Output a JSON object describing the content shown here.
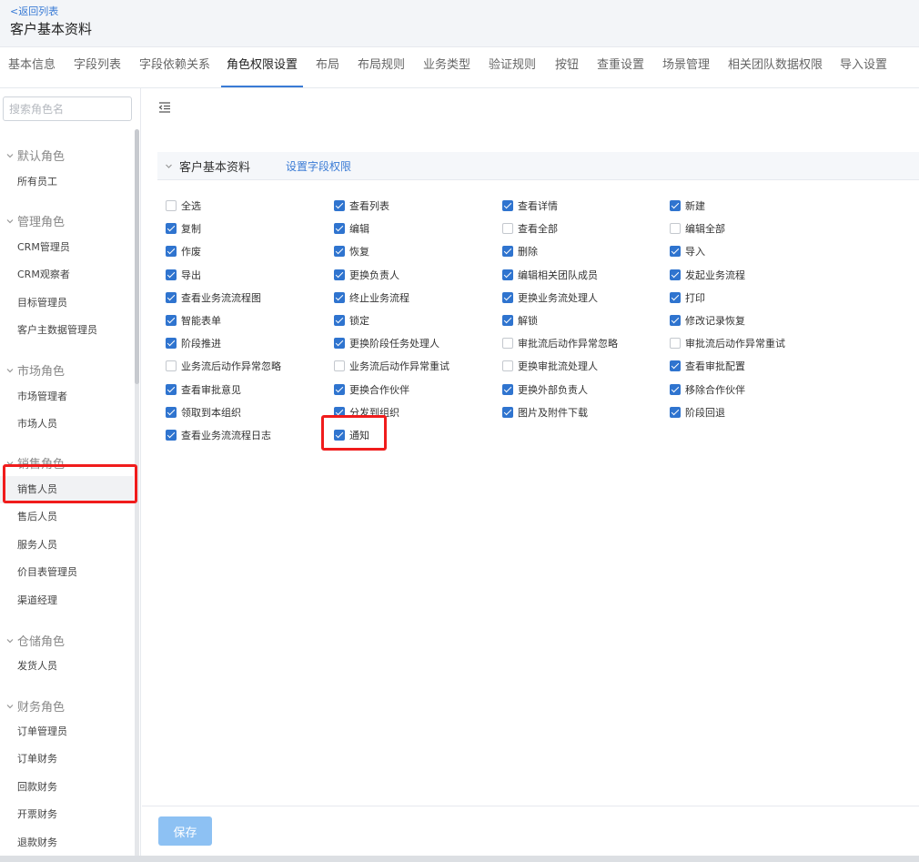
{
  "header": {
    "back_label": "<返回列表",
    "title": "客户基本资料"
  },
  "tabs": [
    "基本信息",
    "字段列表",
    "字段依赖关系",
    "角色权限设置",
    "布局",
    "布局规则",
    "业务类型",
    "验证规则",
    "按钮",
    "查重设置",
    "场景管理",
    "相关团队数据权限",
    "导入设置"
  ],
  "active_tab": "角色权限设置",
  "sidebar": {
    "search_placeholder": "搜索角色名",
    "groups": [
      {
        "label": "默认角色",
        "items": [
          "所有员工"
        ]
      },
      {
        "label": "管理角色",
        "items": [
          "CRM管理员",
          "CRM观察者",
          "目标管理员",
          "客户主数据管理员"
        ]
      },
      {
        "label": "市场角色",
        "items": [
          "市场管理者",
          "市场人员"
        ]
      },
      {
        "label": "销售角色",
        "items": [
          "销售人员",
          "售后人员",
          "服务人员",
          "价目表管理员",
          "渠道经理"
        ]
      },
      {
        "label": "仓储角色",
        "items": [
          "发货人员"
        ]
      },
      {
        "label": "财务角色",
        "items": [
          "订单管理员",
          "订单财务",
          "回款财务",
          "开票财务",
          "退款财务"
        ]
      }
    ],
    "selected_item": "销售人员"
  },
  "section": {
    "title": "客户基本资料",
    "link_label": "设置字段权限"
  },
  "permissions": [
    [
      "全选",
      false
    ],
    [
      "查看列表",
      true
    ],
    [
      "查看详情",
      true
    ],
    [
      "新建",
      true
    ],
    [
      "复制",
      true
    ],
    [
      "编辑",
      true
    ],
    [
      "查看全部",
      false
    ],
    [
      "编辑全部",
      false
    ],
    [
      "作废",
      true
    ],
    [
      "恢复",
      true
    ],
    [
      "删除",
      true
    ],
    [
      "导入",
      true
    ],
    [
      "导出",
      true
    ],
    [
      "更换负责人",
      true
    ],
    [
      "编辑相关团队成员",
      true
    ],
    [
      "发起业务流程",
      true
    ],
    [
      "查看业务流流程图",
      true
    ],
    [
      "终止业务流程",
      true
    ],
    [
      "更换业务流处理人",
      true
    ],
    [
      "打印",
      true
    ],
    [
      "智能表单",
      true
    ],
    [
      "锁定",
      true
    ],
    [
      "解锁",
      true
    ],
    [
      "修改记录恢复",
      true
    ],
    [
      "阶段推进",
      true
    ],
    [
      "更换阶段任务处理人",
      true
    ],
    [
      "审批流后动作异常忽略",
      false
    ],
    [
      "审批流后动作异常重试",
      false
    ],
    [
      "业务流后动作异常忽略",
      false
    ],
    [
      "业务流后动作异常重试",
      false
    ],
    [
      "更换审批流处理人",
      false
    ],
    [
      "查看审批配置",
      true
    ],
    [
      "查看审批意见",
      true
    ],
    [
      "更换合作伙伴",
      true
    ],
    [
      "更换外部负责人",
      true
    ],
    [
      "移除合作伙伴",
      true
    ],
    [
      "领取到本组织",
      true
    ],
    [
      "分发到组织",
      true
    ],
    [
      "图片及附件下载",
      true
    ],
    [
      "阶段回退",
      true
    ],
    [
      "查看业务流流程日志",
      true
    ],
    [
      "通知",
      true
    ]
  ],
  "footer": {
    "save_label": "保存"
  }
}
